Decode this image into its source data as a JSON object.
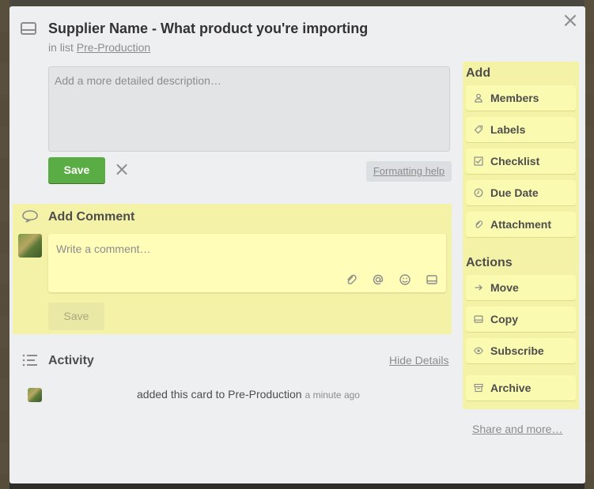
{
  "card": {
    "title": "Supplier Name - What product you're importing",
    "in_list_prefix": "in list",
    "list_name": "Pre-Production"
  },
  "description": {
    "placeholder": "Add a more detailed description…",
    "save_label": "Save",
    "formatting_help": "Formatting help"
  },
  "comment": {
    "heading": "Add Comment",
    "placeholder": "Write a comment…",
    "save_label": "Save",
    "tools": [
      "attachment-icon",
      "mention-icon",
      "emoji-icon",
      "card-icon"
    ]
  },
  "activity": {
    "heading": "Activity",
    "hide_details": "Hide Details",
    "items": [
      {
        "text": "added this card to Pre-Production",
        "time": "a minute ago"
      }
    ]
  },
  "sidebar": {
    "add_heading": "Add",
    "add_items": [
      {
        "label": "Members",
        "icon": "person-icon"
      },
      {
        "label": "Labels",
        "icon": "tag-icon"
      },
      {
        "label": "Checklist",
        "icon": "checkbox-icon"
      },
      {
        "label": "Due Date",
        "icon": "clock-icon"
      },
      {
        "label": "Attachment",
        "icon": "paperclip-icon"
      }
    ],
    "actions_heading": "Actions",
    "action_items": [
      {
        "label": "Move",
        "icon": "arrow-right-icon"
      },
      {
        "label": "Copy",
        "icon": "card-icon"
      },
      {
        "label": "Subscribe",
        "icon": "eye-icon"
      },
      {
        "label": "Archive",
        "icon": "archive-icon"
      }
    ],
    "share_more": "Share and more…"
  },
  "colors": {
    "modal_bg": "#edeff0",
    "highlight_yellow": "#f4f2a7",
    "save_green": "#5aac44"
  }
}
